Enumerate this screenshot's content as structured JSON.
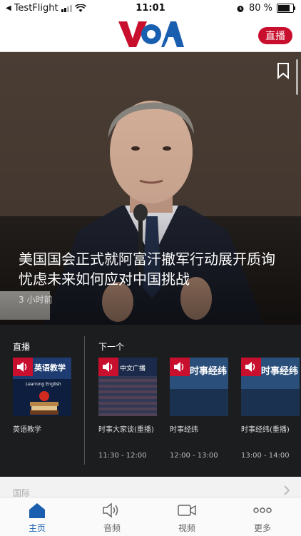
{
  "status_bar": {
    "back_app": "TestFlight",
    "time": "11:01",
    "battery": "80 %",
    "battery_level": 0.8
  },
  "header": {
    "logo_text": "VOA",
    "live_button": "直播",
    "colors": {
      "brand_red": "#c8102e",
      "brand_blue": "#1a5faf"
    }
  },
  "hero": {
    "headline": "美国国会正式就阿富汗撤军行动展开质询 忧虑未来如何应对中国挑战",
    "time_ago": "3 小时前"
  },
  "live": {
    "section_label": "直播",
    "card": {
      "title": "英语教学",
      "image_caption": "英语教学",
      "image_subcaption": "Learning English"
    }
  },
  "up_next": {
    "section_label": "下一个",
    "cards": [
      {
        "title": "时事大家谈(重播)",
        "time": "11:30 - 12:00",
        "image_caption": "中文广播"
      },
      {
        "title": "时事经纬",
        "time": "12:00 - 13:00",
        "image_caption": "时事经纬"
      },
      {
        "title": "时事经纬(重播)",
        "time": "13:00 - 14:00",
        "image_caption": "时事经纬"
      }
    ]
  },
  "next_section": {
    "label": "国际"
  },
  "tabs": [
    {
      "label": "主页",
      "icon": "home-icon",
      "active": true
    },
    {
      "label": "音频",
      "icon": "audio-icon",
      "active": false
    },
    {
      "label": "视频",
      "icon": "video-icon",
      "active": false
    },
    {
      "label": "更多",
      "icon": "more-icon",
      "active": false
    }
  ]
}
